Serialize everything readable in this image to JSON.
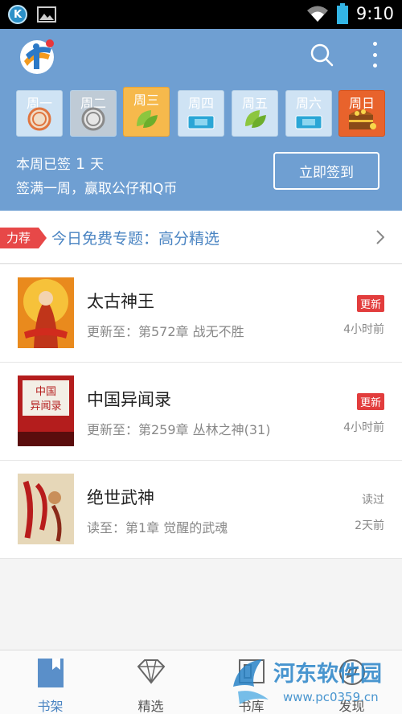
{
  "status_bar": {
    "time": "9:10"
  },
  "week": {
    "days": [
      {
        "label": "周一",
        "icon": "sign-coin-icon"
      },
      {
        "label": "周二",
        "icon": "leak-coin-icon"
      },
      {
        "label": "周三",
        "icon": "leaf-icon"
      },
      {
        "label": "周四",
        "icon": "ticket-icon"
      },
      {
        "label": "周五",
        "icon": "leaf-icon"
      },
      {
        "label": "周六",
        "icon": "ticket-icon"
      },
      {
        "label": "周日",
        "icon": "treasure-chest-icon"
      }
    ],
    "stat_prefix": "本周已签",
    "stat_count": "1",
    "stat_suffix": "天",
    "tip": "签满一周，赢取公仔和Q币",
    "signin_label": "立即签到"
  },
  "topic": {
    "tag": "力荐",
    "text": "今日免费专题：高分精选"
  },
  "books": [
    {
      "title": "太古神王",
      "progress": "更新至：第572章 战无不胜",
      "badge": "更新",
      "time": "4小时前"
    },
    {
      "title": "中国异闻录",
      "progress": "更新至：第259章 丛林之神(31)",
      "badge": "更新",
      "time": "4小时前"
    },
    {
      "title": "绝世武神",
      "progress": "读至：第1章 觉醒的武魂",
      "badge": "读过",
      "time": "2天前"
    }
  ],
  "covers": {
    "book2_line1": "中国",
    "book2_line2": "异闻录"
  },
  "nav": {
    "tabs": [
      {
        "label": "书架"
      },
      {
        "label": "精选"
      },
      {
        "label": "书库"
      },
      {
        "label": "发现"
      }
    ]
  },
  "watermark": {
    "title": "河东软件园",
    "url": "www.pc0359.cn"
  },
  "colors": {
    "header_bg": "#6f9fd2",
    "accent": "#4a84c2",
    "badge_red": "#e23d3d"
  }
}
